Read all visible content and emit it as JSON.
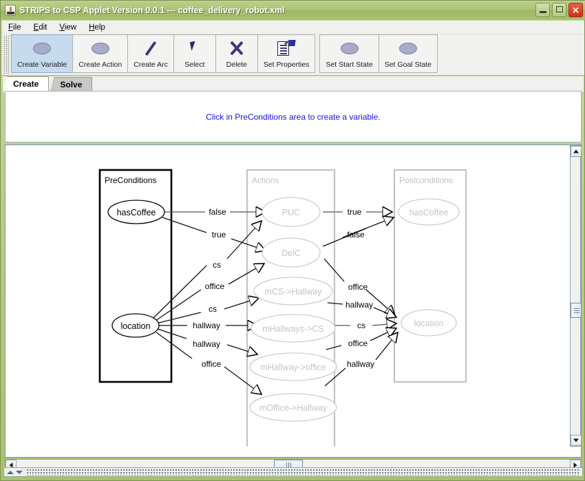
{
  "window": {
    "title": "STRIPS to CSP Applet Version 0.0.1 --- coffee_delivery_robot.xml",
    "icon": "java-applet-icon",
    "buttons": {
      "minimize": "minimize-icon",
      "maximize": "maximize-icon",
      "close": "close-icon"
    }
  },
  "menubar": {
    "items": [
      {
        "label": "File",
        "mnemonic": "F"
      },
      {
        "label": "Edit",
        "mnemonic": "E"
      },
      {
        "label": "View",
        "mnemonic": "V"
      },
      {
        "label": "Help",
        "mnemonic": "H"
      }
    ]
  },
  "toolbar": {
    "buttons": [
      {
        "label": "Create Variable",
        "icon": "oval-icon",
        "selected": true
      },
      {
        "label": "Create Action",
        "icon": "oval-icon",
        "selected": false
      },
      {
        "label": "Create Arc",
        "icon": "line-icon",
        "selected": false
      },
      {
        "label": "Select",
        "icon": "cursor-arrow-icon",
        "selected": false
      },
      {
        "label": "Delete",
        "icon": "x-cross-icon",
        "selected": false
      },
      {
        "label": "Set Properties",
        "icon": "properties-clipboard-icon",
        "selected": false
      }
    ],
    "buttons_group2": [
      {
        "label": "Set Start State",
        "icon": "oval-icon",
        "selected": false
      },
      {
        "label": "Set Goal State",
        "icon": "oval-icon",
        "selected": false
      }
    ]
  },
  "tabs": [
    {
      "label": "Create",
      "selected": true
    },
    {
      "label": "Solve",
      "selected": false
    }
  ],
  "message": {
    "text": "Click in PreConditions area to create a variable.",
    "color": "#1414e0"
  },
  "graph": {
    "columns": [
      {
        "id": "pre",
        "title": "PreConditions",
        "active": true
      },
      {
        "id": "actions",
        "title": "Actions",
        "active": false
      },
      {
        "id": "post",
        "title": "Postconditions",
        "active": false
      }
    ],
    "nodes": [
      {
        "id": "pre-hasCoffee",
        "label": "hasCoffee",
        "column": "pre",
        "active": true
      },
      {
        "id": "pre-location",
        "label": "location",
        "column": "pre",
        "active": true
      },
      {
        "id": "act-PUC",
        "label": "PUC",
        "column": "actions",
        "active": false
      },
      {
        "id": "act-DelC",
        "label": "DelC",
        "column": "actions",
        "active": false
      },
      {
        "id": "act-mCS-Hallway",
        "label": "mCS->Hallway",
        "column": "actions",
        "active": false
      },
      {
        "id": "act-mHallways-CS",
        "label": "mHallways->CS",
        "column": "actions",
        "active": false
      },
      {
        "id": "act-mHallway-office",
        "label": "mHallway->office",
        "column": "actions",
        "active": false
      },
      {
        "id": "act-mOffice-Hallway",
        "label": "mOffice->Hallway",
        "column": "actions",
        "active": false
      },
      {
        "id": "post-hasCoffee",
        "label": "hasCoffee",
        "column": "post",
        "active": false
      },
      {
        "id": "post-location",
        "label": "location",
        "column": "post",
        "active": false
      }
    ],
    "edges_pre_to_action": [
      {
        "from": "pre-hasCoffee",
        "to": "act-PUC",
        "label": "false"
      },
      {
        "from": "pre-hasCoffee",
        "to": "act-DelC",
        "label": "true"
      },
      {
        "from": "pre-location",
        "to": "act-PUC",
        "label": "cs"
      },
      {
        "from": "pre-location",
        "to": "act-DelC",
        "label": "office"
      },
      {
        "from": "pre-location",
        "to": "act-mCS->Hallway",
        "label": "cs"
      },
      {
        "from": "pre-location",
        "to": "act-mHallways->CS",
        "label": "hallway"
      },
      {
        "from": "pre-location",
        "to": "act-mHallway->office",
        "label": "hallway"
      },
      {
        "from": "pre-location",
        "to": "act-mOffice->Hallway",
        "label": "office"
      }
    ],
    "edges_action_to_post": [
      {
        "from": "act-PUC",
        "to": "post-hasCoffee",
        "label": "true"
      },
      {
        "from": "act-DelC",
        "to": "post-hasCoffee",
        "label": "false"
      },
      {
        "from": "act-DelC",
        "to": "post-location",
        "label": "office"
      },
      {
        "from": "act-mCS->Hallway",
        "to": "post-location",
        "label": "hallway"
      },
      {
        "from": "act-mHallways->CS",
        "to": "post-location",
        "label": "cs"
      },
      {
        "from": "act-mHallway->office",
        "to": "post-location",
        "label": "office"
      },
      {
        "from": "act-mOffice->Hallway",
        "to": "post-location",
        "label": "hallway"
      }
    ]
  },
  "scrollbars": {
    "vertical": {
      "thumb_position_pct": 52
    },
    "horizontal": {
      "thumb_position_pct": 48
    }
  }
}
